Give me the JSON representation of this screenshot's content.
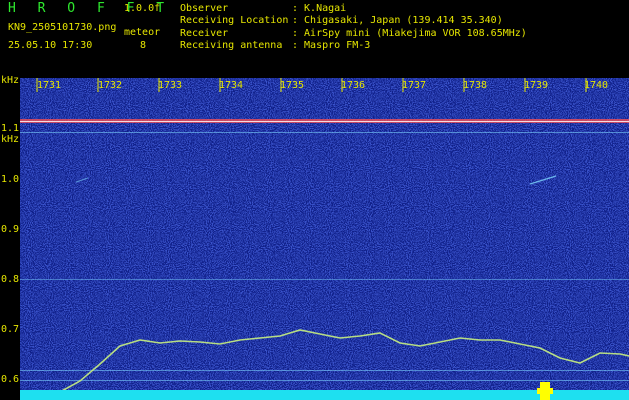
{
  "header": {
    "app_title": "H R O F F T",
    "version": "1.0.0f",
    "file_name": "KN9_2505101730.png",
    "meteor_label": "meteor",
    "datetime": "25.05.10 17:30",
    "meteor_count": "8"
  },
  "info": [
    {
      "key": "Observer",
      "value": ": K.Nagai"
    },
    {
      "key": "Receiving Location",
      "value": ": Chigasaki, Japan (139.414 35.340)"
    },
    {
      "key": "Receiver",
      "value": ": AirSpy mini (Miakejima VOR 108.65MHz)"
    },
    {
      "key": "Receiving antenna",
      "value": ": Maspro FM-3"
    }
  ],
  "axis": {
    "unit_label": "kHz",
    "y_ticks": [
      "1.1",
      "1.0",
      "0.9",
      "0.8",
      "0.7",
      "0.6"
    ],
    "x_ticks": [
      "1731",
      "1732",
      "1733",
      "1734",
      "1735",
      "1736",
      "1737",
      "1738",
      "1739",
      "1740"
    ]
  },
  "colors": {
    "background": "#000000",
    "spectrum": "#10208a",
    "text": "#e6e600",
    "title": "#2ee82e",
    "noise_floor": "#1ee0f0",
    "carrier": "#ff5050",
    "meteor_blip": "#ffff00"
  }
}
